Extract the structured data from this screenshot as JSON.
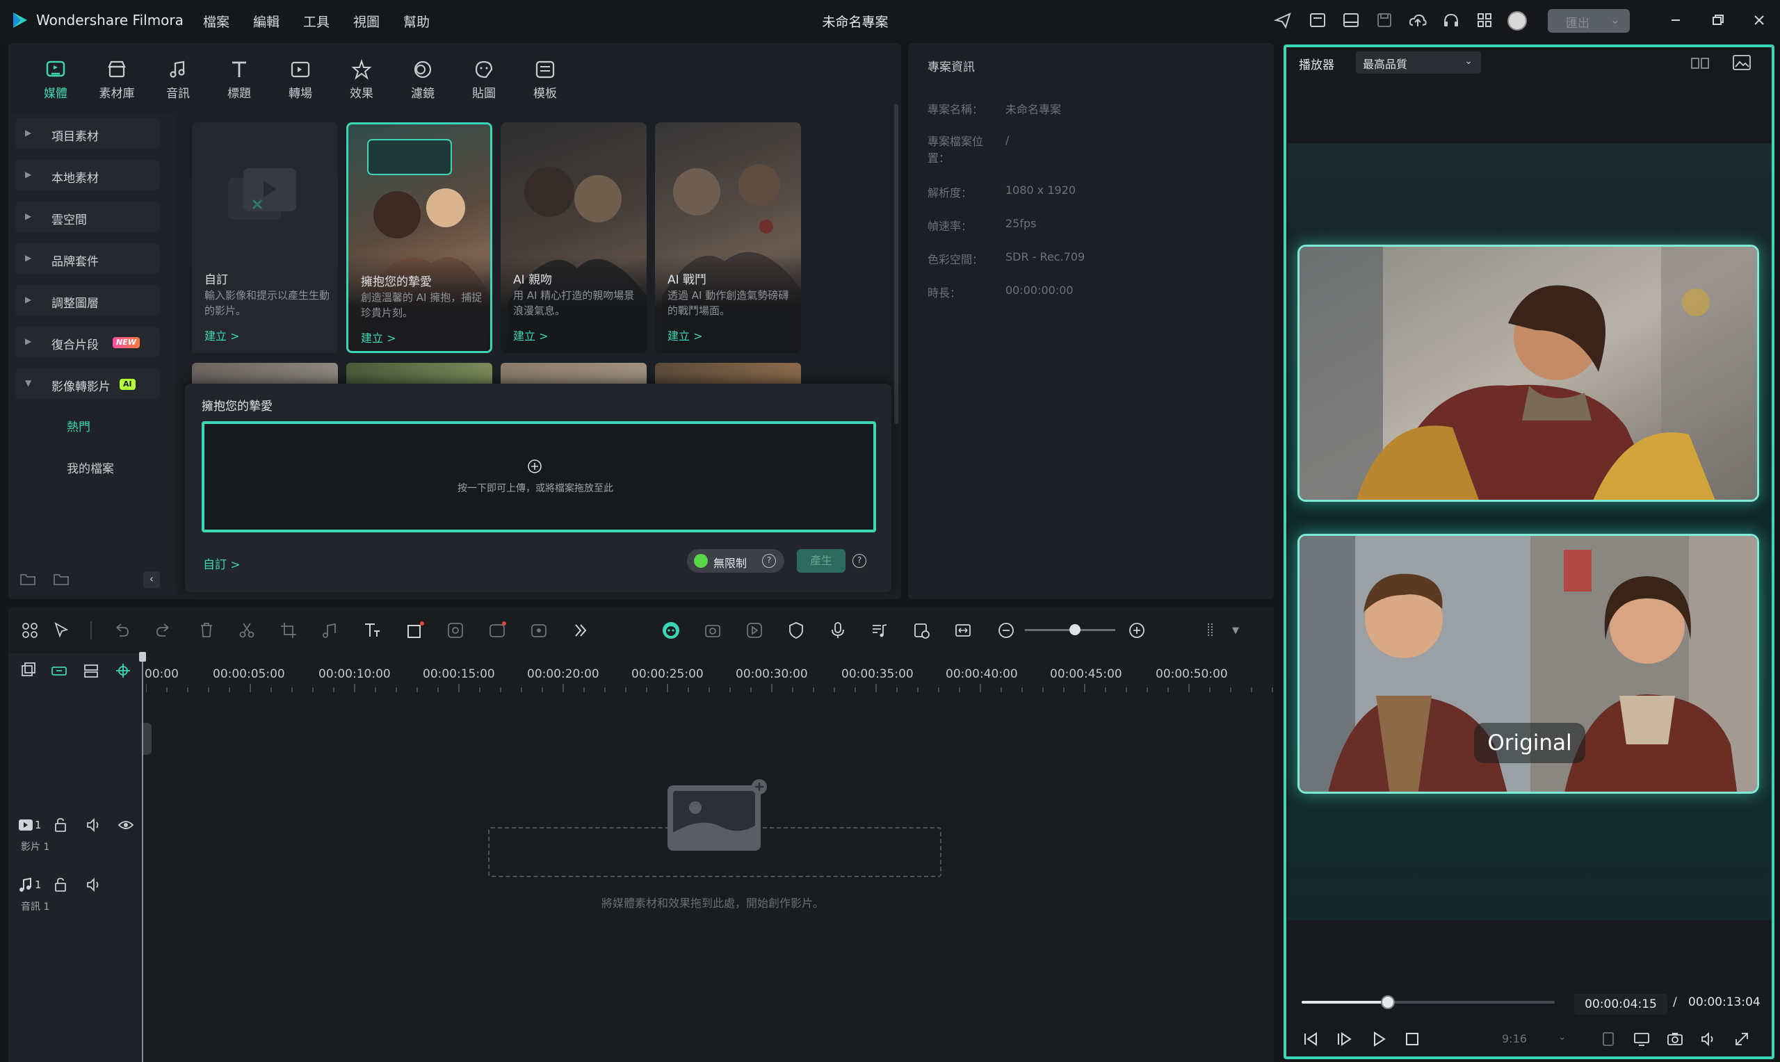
{
  "app": {
    "name": "Wondershare Filmora",
    "project_title": "未命名專案",
    "menu": [
      "檔案",
      "編輯",
      "工具",
      "視圖",
      "幫助"
    ],
    "export_label": "匯出",
    "accent_color": "#3bd6b5"
  },
  "toolbar": {
    "tabs": [
      {
        "label": "媒體",
        "icon": "media-icon",
        "active": true
      },
      {
        "label": "素材庫",
        "icon": "stock-icon"
      },
      {
        "label": "音訊",
        "icon": "music-icon"
      },
      {
        "label": "標題",
        "icon": "title-icon"
      },
      {
        "label": "轉場",
        "icon": "transition-icon"
      },
      {
        "label": "效果",
        "icon": "effects-icon"
      },
      {
        "label": "濾鏡",
        "icon": "filter-icon"
      },
      {
        "label": "貼圖",
        "icon": "sticker-icon"
      },
      {
        "label": "模板",
        "icon": "template-icon"
      }
    ]
  },
  "sidebar": {
    "items": [
      {
        "label": "項目素材"
      },
      {
        "label": "本地素材"
      },
      {
        "label": "雲空間"
      },
      {
        "label": "品牌套件"
      },
      {
        "label": "調整圖層"
      },
      {
        "label": "復合片段",
        "badge": "NEW"
      },
      {
        "label": "影像轉影片",
        "badge": "AI",
        "expanded": true
      }
    ],
    "sub_items": [
      "熱門",
      "我的檔案"
    ]
  },
  "templates": [
    {
      "title": "自訂",
      "desc": "輸入影像和提示以產生生動的影片。",
      "cta": "建立 >"
    },
    {
      "title": "擁抱您的摯愛",
      "desc": "創造溫馨的 AI 擁抱，捕捉珍貴片刻。",
      "cta": "建立 >"
    },
    {
      "title": "AI 親吻",
      "desc": "用 AI 精心打造的親吻場景浪漫氣息。",
      "cta": "建立 >"
    },
    {
      "title": "AI 戰鬥",
      "desc": "透過 AI 動作創造氣勢磅礴的戰鬥場面。",
      "cta": "建立 >"
    }
  ],
  "upload_popup": {
    "title": "擁抱您的摯愛",
    "hint": "按一下即可上傳，或將檔案拖放至此",
    "custom_link": "自訂 >",
    "unlimited_label": "無限制",
    "generate_label": "產生"
  },
  "project_info": {
    "title": "專案資訊",
    "fields": [
      {
        "key": "專案名稱：",
        "value": "未命名專案"
      },
      {
        "key": "專案檔案位置：",
        "value": "/"
      },
      {
        "key": "解析度：",
        "value": "1080 x 1920"
      },
      {
        "key": "幀速率：",
        "value": "25fps"
      },
      {
        "key": "色彩空間：",
        "value": "SDR - Rec.709"
      },
      {
        "key": "時長：",
        "value": "00:00:00:00"
      }
    ]
  },
  "player": {
    "label": "播放器",
    "quality": "最高品質",
    "overlay_text": "Original",
    "current_time": "00:00:04:15",
    "separator": "/",
    "total_time": "00:00:13:04",
    "progress": 0.34,
    "ratio": "9:16"
  },
  "timeline": {
    "ruler": [
      "00:00",
      "00:00:05:00",
      "00:00:10:00",
      "00:00:15:00",
      "00:00:20:00",
      "00:00:25:00",
      "00:00:30:00",
      "00:00:35:00",
      "00:00:40:00",
      "00:00:45:00",
      "00:00:50:00"
    ],
    "video_track_num": "1",
    "video_track_label": "影片 1",
    "audio_track_num": "1",
    "audio_track_label": "音訊 1",
    "empty_hint": "將媒體素材和效果拖到此處，開始創作影片。",
    "zoom_level": 0.55
  }
}
